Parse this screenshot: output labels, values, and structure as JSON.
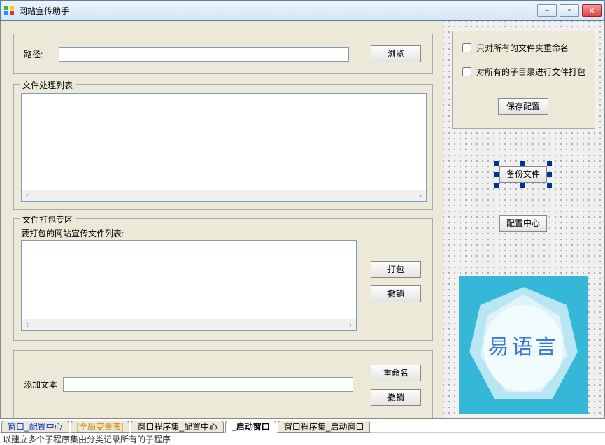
{
  "window": {
    "title": "网站宣传助手"
  },
  "controls": {
    "min": "–",
    "max": "▫",
    "close": "✕"
  },
  "path": {
    "label": "路径:",
    "value": "",
    "browse": "浏览"
  },
  "fileList": {
    "legend": "文件处理列表",
    "content": ""
  },
  "packZone": {
    "legend": "文件打包专区",
    "sublabel": "要打包的网站宣传文件列表:",
    "content": "",
    "pack": "打包",
    "undo": "撤销"
  },
  "addText": {
    "label": "添加文本",
    "value": "",
    "rename": "重命名",
    "undo": "撤销"
  },
  "rightTop": {
    "chkRenameFolders": "只对所有的文件夹重命名",
    "chkPackSubdirs": "对所有的子目录进行文件打包",
    "saveConfig": "保存配置"
  },
  "backupBtn": "备份文件",
  "configCenter": "配置中心",
  "logo": "易语言",
  "tabs": {
    "t1": "窗口_配置中心",
    "t2": "[全局变量表]",
    "t3": "窗口程序集_配置中心",
    "t4": "_启动窗口",
    "t5": "窗口程序集_启动窗口"
  },
  "status": "以建立多个子程序集由分类记录所有的子程序"
}
